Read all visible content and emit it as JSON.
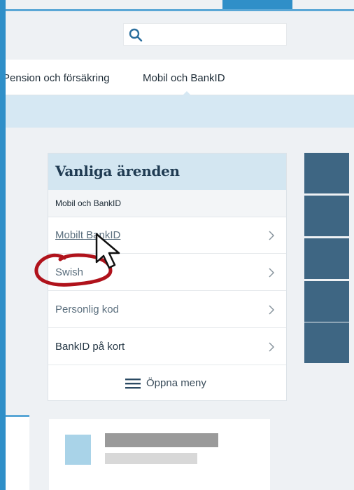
{
  "search": {
    "placeholder": "",
    "value": ""
  },
  "nav": {
    "tabs": [
      {
        "label": "Pension och försäkring"
      },
      {
        "label": "Mobil och BankID"
      }
    ]
  },
  "panel": {
    "title": "Vanliga ärenden",
    "subtitle": "Mobil och BankID",
    "items": [
      {
        "label": "Mobilt BankID"
      },
      {
        "label": "Swish"
      },
      {
        "label": "Personlig kod"
      },
      {
        "label": "BankID på kort"
      }
    ],
    "open_menu_label": "Öppna meny"
  },
  "colors": {
    "frame": "#2f8fc8",
    "panel_header": "#d3e6f1",
    "tile": "#3e6683",
    "annotation": "#b0121b"
  },
  "icons": [
    "search-icon",
    "chevron-right-icon",
    "hamburger-icon",
    "mouse-cursor-icon"
  ]
}
